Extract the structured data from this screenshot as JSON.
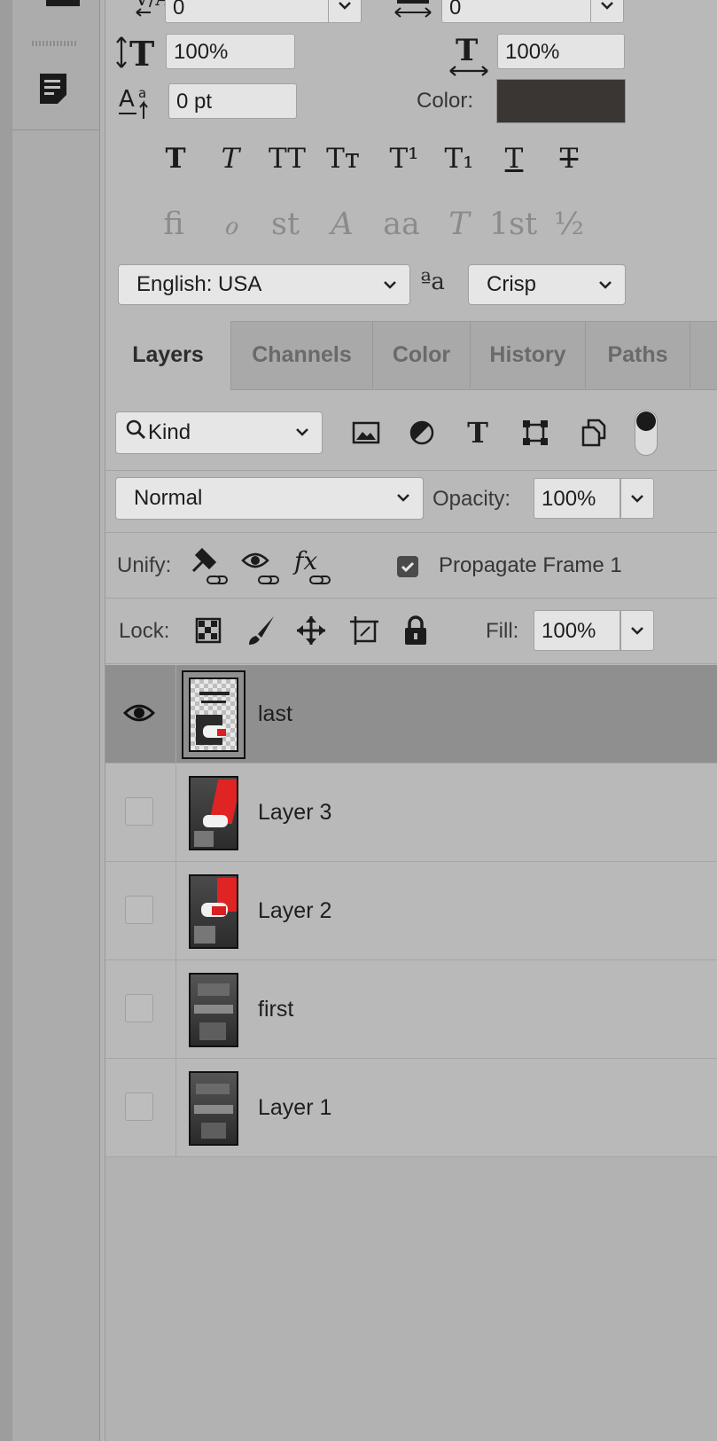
{
  "character": {
    "tracking_value": "0",
    "kerning_value": "0",
    "vertical_scale": "100%",
    "horizontal_scale": "100%",
    "baseline_shift": "0 pt",
    "color_label": "Color:",
    "color_value": "#3a3633",
    "style_buttons": [
      "T",
      "T",
      "TT",
      "Tт",
      "T¹",
      "T₁",
      "T",
      "T"
    ],
    "opentype_buttons": [
      "ﬁ",
      "ℴ",
      "st",
      "A",
      "aa",
      "T",
      "1st",
      "½"
    ],
    "language": "English: USA",
    "aa_icon": "ªa",
    "antialias": "Crisp"
  },
  "tabs": [
    {
      "label": "Layers",
      "active": true
    },
    {
      "label": "Channels",
      "active": false
    },
    {
      "label": "Color",
      "active": false
    },
    {
      "label": "History",
      "active": false
    },
    {
      "label": "Paths",
      "active": false
    }
  ],
  "filter": {
    "kind_label": "Kind",
    "icons": [
      "image-filter-icon",
      "adjustment-filter-icon",
      "type-filter-icon",
      "shape-filter-icon",
      "smart-object-filter-icon"
    ]
  },
  "blend": {
    "mode": "Normal",
    "opacity_label": "Opacity:",
    "opacity_value": "100%"
  },
  "unify": {
    "label": "Unify:",
    "propagate_label": "Propagate Frame 1",
    "propagate_checked": true
  },
  "lock": {
    "label": "Lock:",
    "fill_label": "Fill:",
    "fill_value": "100%"
  },
  "layers": [
    {
      "name": "last",
      "visible": true,
      "selected": true
    },
    {
      "name": "Layer 3",
      "visible": false,
      "selected": false
    },
    {
      "name": "Layer 2",
      "visible": false,
      "selected": false
    },
    {
      "name": "first",
      "visible": false,
      "selected": false
    },
    {
      "name": "Layer 1",
      "visible": false,
      "selected": false
    }
  ]
}
